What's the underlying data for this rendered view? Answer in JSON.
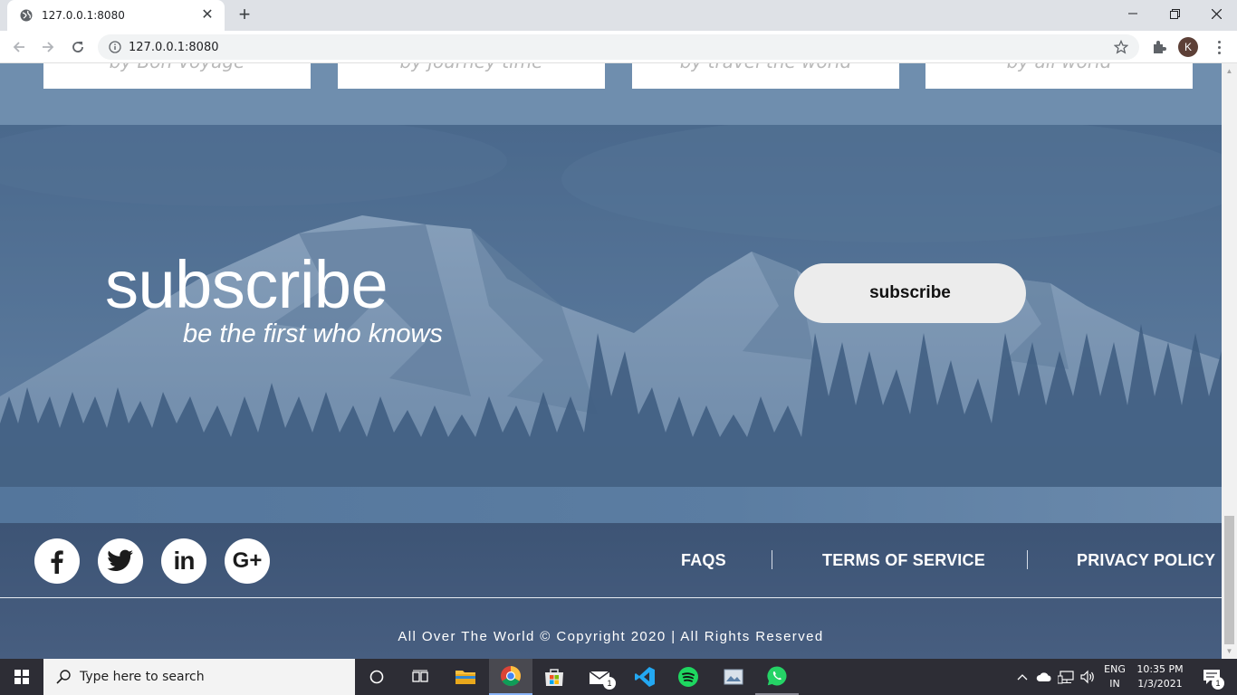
{
  "browser": {
    "tab_title": "127.0.0.1:8080",
    "close_tab": "✕",
    "new_tab": "+",
    "url": "127.0.0.1:8080",
    "profile_initial": "K"
  },
  "cards": [
    {
      "label": "by Bon Voyage"
    },
    {
      "label": "by journey time"
    },
    {
      "label": "by travel the world"
    },
    {
      "label": "by all world"
    }
  ],
  "subscribe": {
    "title": "subscribe",
    "tagline": "be the first who knows",
    "button_label": "subscribe"
  },
  "footer": {
    "social": [
      {
        "icon": "facebook-icon",
        "glyph": "f"
      },
      {
        "icon": "twitter-icon",
        "glyph": ""
      },
      {
        "icon": "linkedin-icon",
        "glyph": "in"
      },
      {
        "icon": "google-plus-icon",
        "glyph": "G+"
      }
    ],
    "links": [
      "FAQS",
      "TERMS OF SERVICE",
      "PRIVACY POLICY"
    ],
    "copyright": "All Over The World © Copyright 2020 | All Rights Reserved"
  },
  "taskbar": {
    "search_placeholder": "Type here to search",
    "mail_badge": "1",
    "lang_primary": "ENG",
    "lang_secondary": "IN",
    "time": "10:35 PM",
    "date": "1/3/2021",
    "notification_count": "1"
  },
  "colors": {
    "footer": "#3d5475",
    "hero_overlay": "#55759a",
    "button_bg": "#ececec"
  }
}
